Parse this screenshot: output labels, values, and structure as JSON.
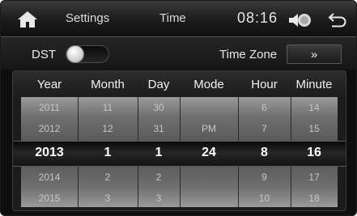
{
  "header": {
    "settings_label": "Settings",
    "page_label": "Time",
    "clock": "08:16"
  },
  "options": {
    "dst_label": "DST",
    "dst_on": false,
    "timezone_label": "Time Zone",
    "timezone_button": "»"
  },
  "picker": {
    "columns": [
      "Year",
      "Month",
      "Day",
      "Mode",
      "Hour",
      "Minute"
    ],
    "rows": [
      [
        "2011",
        "11",
        "30",
        "",
        "6",
        "14"
      ],
      [
        "2012",
        "12",
        "31",
        "PM",
        "7",
        "15"
      ],
      [
        "2013",
        "1",
        "1",
        "24",
        "8",
        "16"
      ],
      [
        "2014",
        "2",
        "2",
        "",
        "9",
        "17"
      ],
      [
        "2015",
        "3",
        "3",
        "",
        "10",
        "18"
      ]
    ],
    "selected_row": 2
  },
  "icons": [
    "home-icon",
    "volume-icon",
    "back-arrow-icon",
    "double-chevron-right-icon"
  ]
}
